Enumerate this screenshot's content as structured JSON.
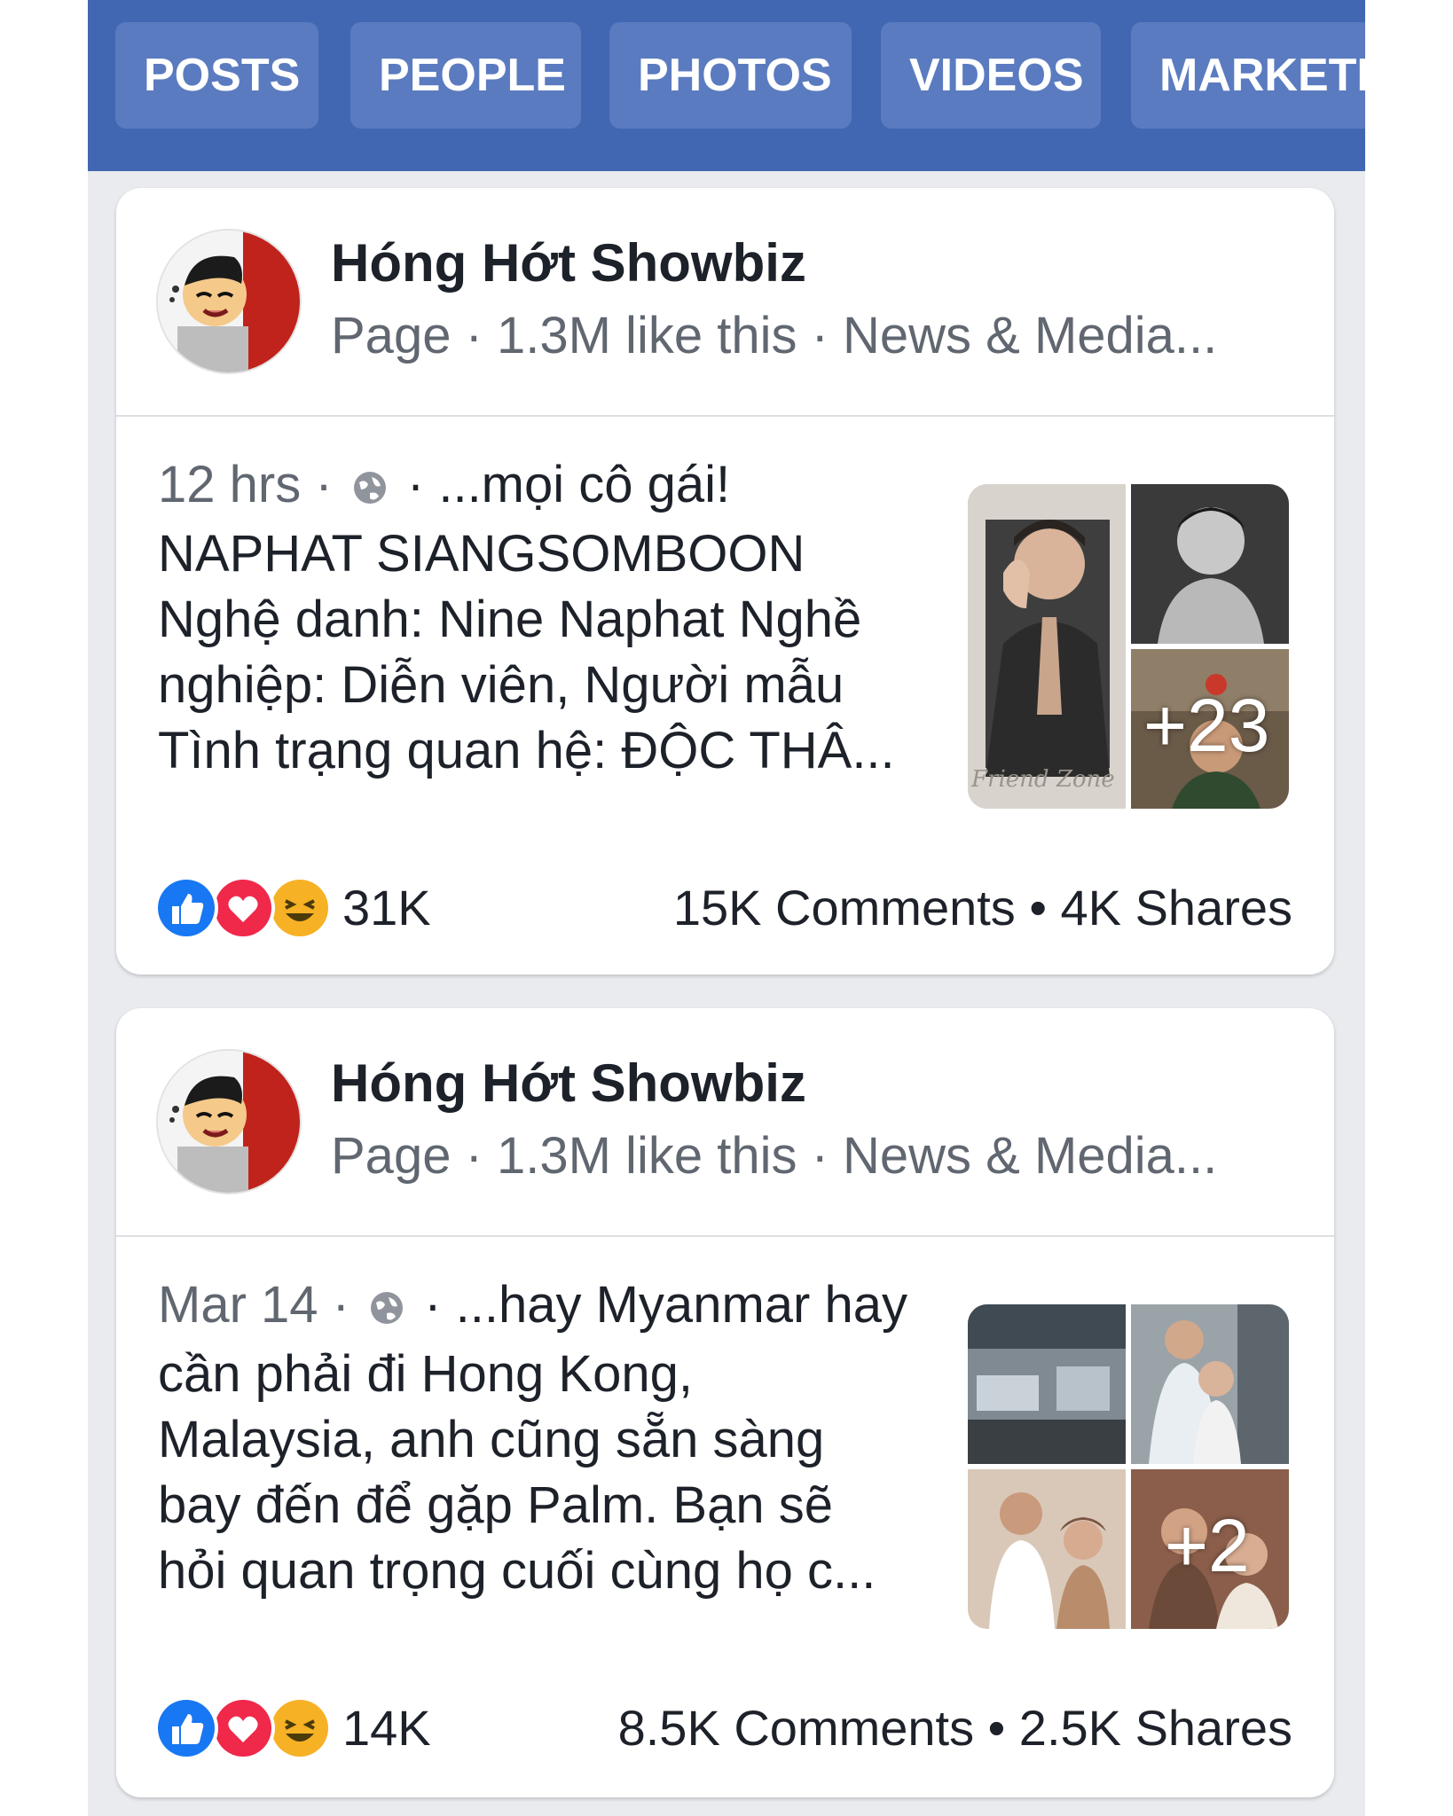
{
  "tabs": [
    "POSTS",
    "PEOPLE",
    "PHOTOS",
    "VIDEOS",
    "MARKETPLACE"
  ],
  "colors": {
    "header": "#4267b2",
    "tab_bg": "#5b7bc0",
    "like": "#1877f2",
    "love": "#f0284a",
    "haha": "#f7b125"
  },
  "posts": [
    {
      "page_name": "Hóng Hớt Showbiz",
      "page_meta": "Page · 1.3M like this · News & Media...",
      "time": "12 hrs",
      "lines": [
        "· ...mọi cô gái!",
        "NAPHAT SIANGSOMBOON",
        "Nghệ danh: Nine Naphat Nghề",
        "nghiệp: Diễn viên, Người mẫu",
        "Tình trạng quan hệ: ĐỘC THÂ..."
      ],
      "more_photos": "+23",
      "photo_caption": "Friend Zone",
      "reactions_icons": [
        "like-icon",
        "love-icon",
        "haha-icon"
      ],
      "reactions_count": "31K",
      "comments_shares": "15K Comments • 4K Shares"
    },
    {
      "page_name": "Hóng Hớt Showbiz",
      "page_meta": "Page · 1.3M like this · News & Media...",
      "time": "Mar 14",
      "lines": [
        "· ...hay Myanmar hay",
        "cần phải đi Hong Kong,",
        "Malaysia, anh cũng sẵn sàng",
        "bay đến để gặp Palm. Bạn sẽ",
        "hỏi quan trọng cuối cùng họ c..."
      ],
      "more_photos": "+2",
      "reactions_icons": [
        "like-icon",
        "love-icon",
        "haha-icon"
      ],
      "reactions_count": "14K",
      "comments_shares": "8.5K Comments • 2.5K Shares"
    }
  ]
}
